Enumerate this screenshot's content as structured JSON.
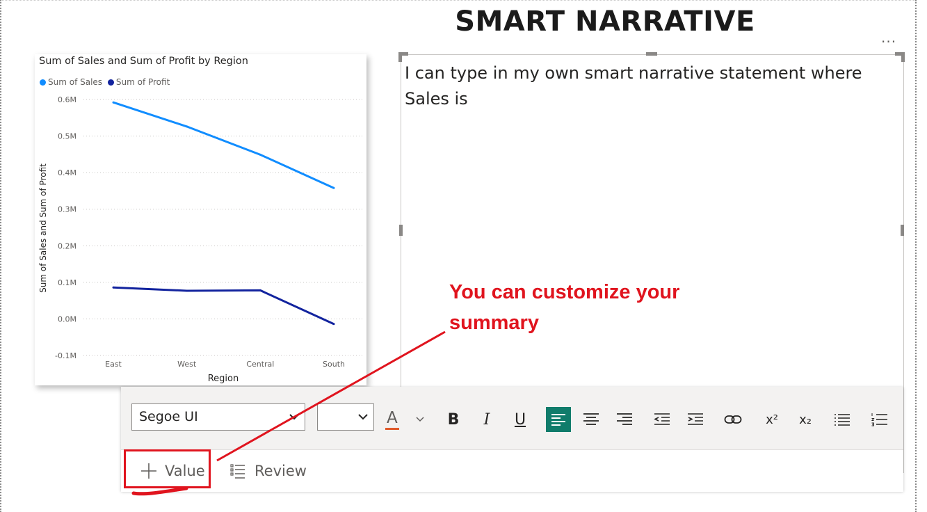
{
  "page": {
    "title": "SMART NARRATIVE"
  },
  "chart_data": {
    "type": "line",
    "title": "Sum of Sales and Sum of Profit by Region",
    "xlabel": "Region",
    "ylabel": "Sum of Sales and Sum of Profit",
    "categories": [
      "East",
      "West",
      "Central",
      "South"
    ],
    "series": [
      {
        "name": "Sum of Sales",
        "color": "#118dff",
        "values": [
          0.592,
          0.526,
          0.449,
          0.358
        ]
      },
      {
        "name": "Sum of Profit",
        "color": "#12239e",
        "values": [
          0.086,
          0.077,
          0.078,
          -0.014
        ]
      }
    ],
    "yticks": [
      {
        "value": 0.6,
        "label": "0.6M"
      },
      {
        "value": 0.5,
        "label": "0.5M"
      },
      {
        "value": 0.4,
        "label": "0.4M"
      },
      {
        "value": 0.3,
        "label": "0.3M"
      },
      {
        "value": 0.2,
        "label": "0.2M"
      },
      {
        "value": 0.1,
        "label": "0.1M"
      },
      {
        "value": 0.0,
        "label": "0.0M"
      },
      {
        "value": -0.1,
        "label": "-0.1M"
      }
    ],
    "ylim": [
      -0.1,
      0.6
    ],
    "grid": true,
    "legend_position": "top-left",
    "unit": "M"
  },
  "narrative": {
    "text": "I can type in my own smart narrative statement where Sales is"
  },
  "annotation": {
    "text": "You can customize your summary",
    "color": "#e0141e"
  },
  "toolbar": {
    "font_family_value": "Segoe UI",
    "font_size_value": "",
    "bold_label": "B",
    "italic_label": "I",
    "underline_label": "U",
    "font_color_label": "A",
    "superscript_label": "x²",
    "subscript_label": "x₂",
    "value_label": "Value",
    "review_label": "Review",
    "active_color": "#107c6b",
    "font_color_underline": "#e05a2b"
  }
}
